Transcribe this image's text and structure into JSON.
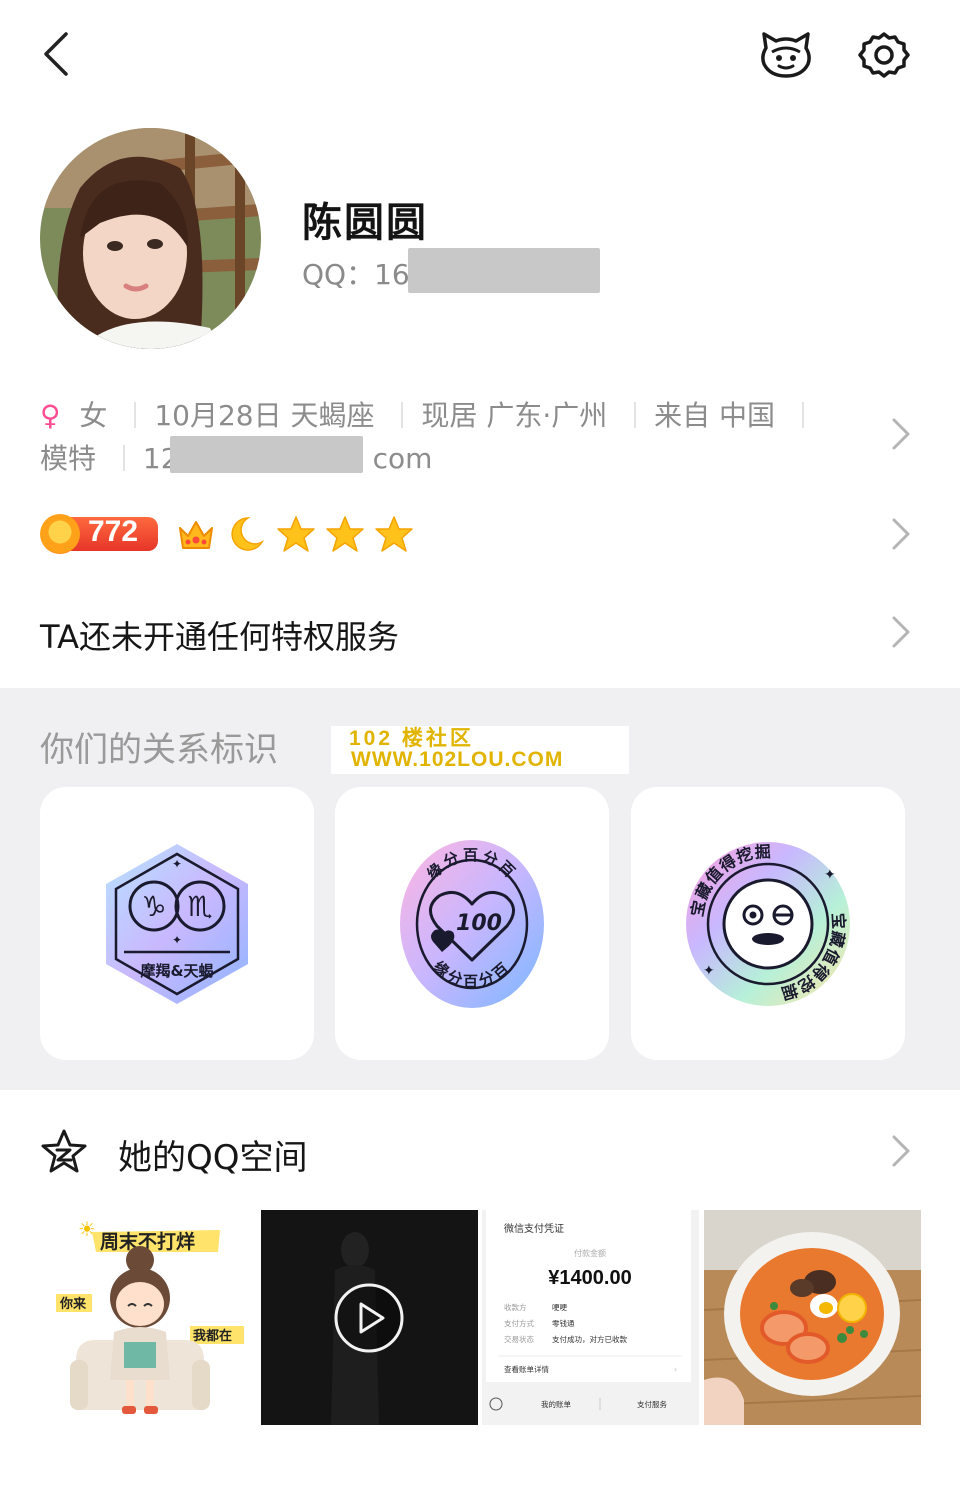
{
  "profile": {
    "name": "陈圆圆",
    "qq_label": "QQ：16"
  },
  "info": {
    "gender_symbol": "♀",
    "gender": "女",
    "birthday": "10月28日 天蝎座",
    "residence": "现居 广东·广州",
    "origin": "来自 中国",
    "occupation": "模特",
    "email_prefix": "12",
    "email_suffix": "com"
  },
  "badges": {
    "points": "772",
    "level_icons": [
      "crown-icon",
      "moon-icon",
      "star-icon",
      "star-icon",
      "star-icon"
    ]
  },
  "privilege_text": "TA还未开通任何特权服务",
  "relation": {
    "title": "你们的关系标识",
    "watermark_line1": "102 楼社区",
    "watermark_line2": "WWW.102LOU.COM",
    "cards": [
      {
        "label": "摩羯&天蝎"
      },
      {
        "ring_text": "缘分百分百",
        "number": "100"
      },
      {
        "ring_text": "宝藏值得挖掘"
      }
    ]
  },
  "qzone": {
    "title": "她的QQ空间",
    "thumb1": {
      "title": "周末不打烊",
      "left": "你来",
      "right": "我都在"
    },
    "thumb3": {
      "title": "微信支付凭证",
      "amount_label": "付款金额",
      "amount": "¥1400.00",
      "rows": [
        {
          "k": "收款方",
          "v": "哽哽"
        },
        {
          "k": "支付方式",
          "v": "零钱通"
        },
        {
          "k": "交易状态",
          "v": "支付成功，对方已收款"
        }
      ],
      "detail_link": "查看账单详情",
      "tabs": [
        "我的账单",
        "支付服务"
      ]
    }
  },
  "colors": {
    "accent_female": "#ff4d94",
    "points_orange": "#e6352a",
    "section_bg": "#f0f0f2",
    "watermark": "#e0b400"
  }
}
